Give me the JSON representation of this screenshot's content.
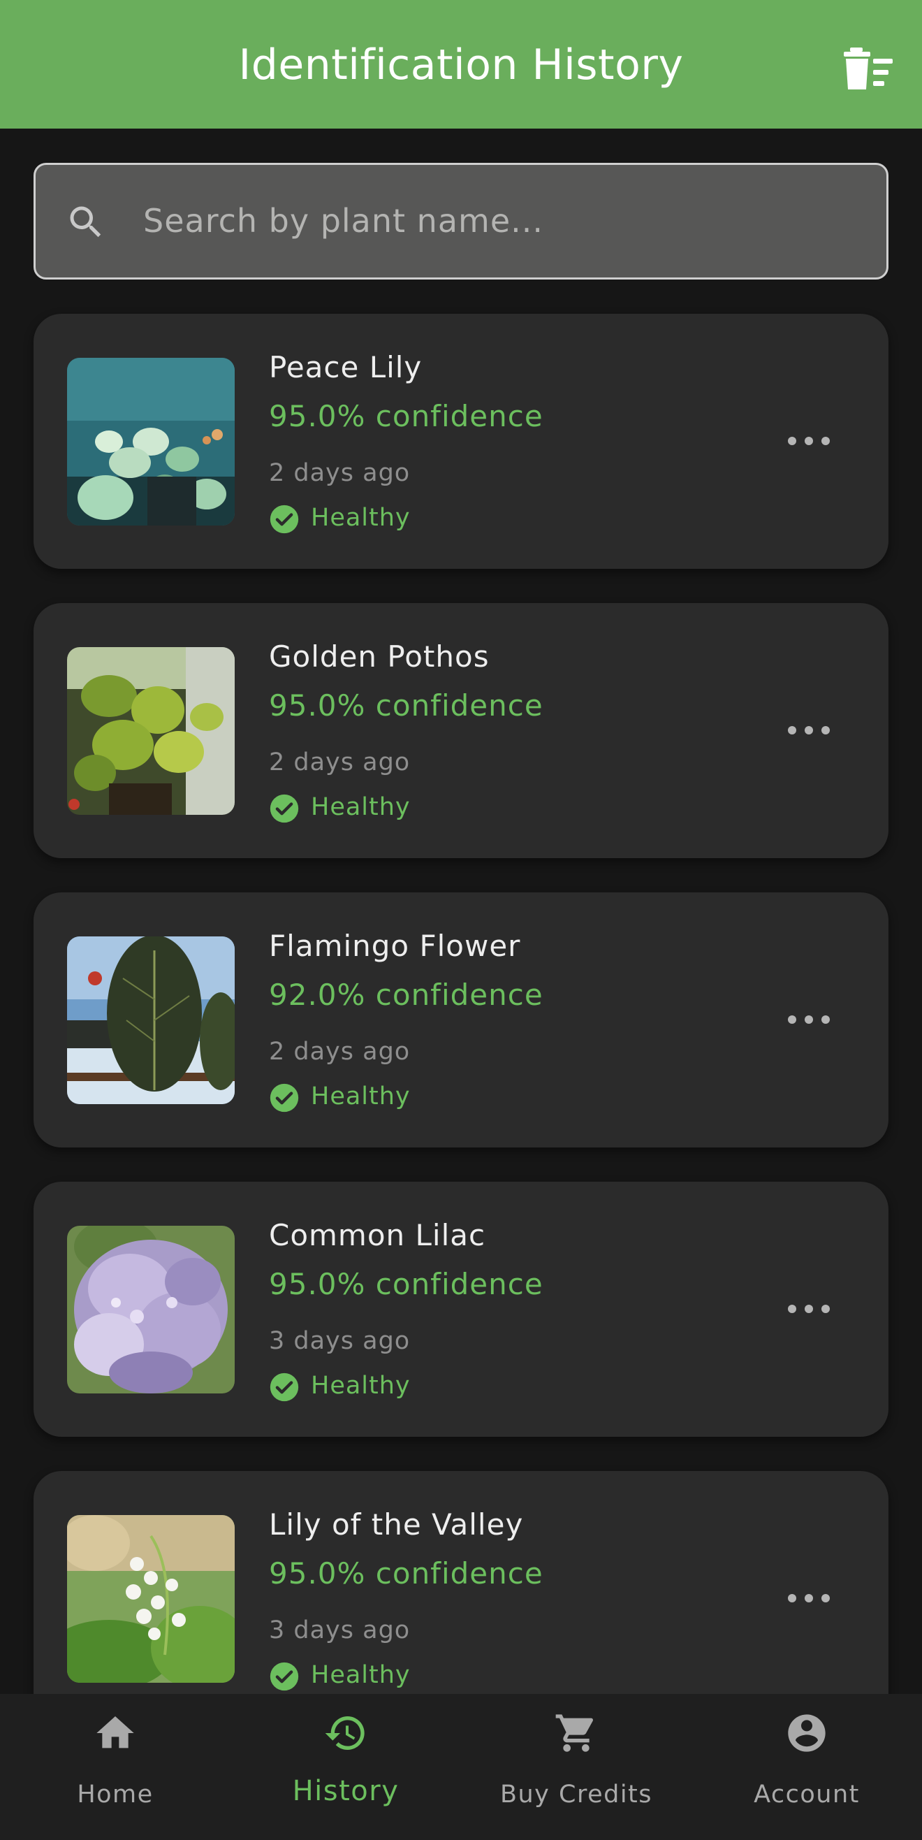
{
  "header": {
    "title": "Identification History",
    "delete_icon": "delete-sweep-icon"
  },
  "search": {
    "placeholder": "Search by plant name...",
    "value": "",
    "icon": "search-icon"
  },
  "items": [
    {
      "name": "Peace Lily",
      "confidence": "95.0% confidence",
      "time": "2 days ago",
      "status": "Healthy",
      "status_icon": "check-circle-icon",
      "more_icon": "more-horizontal-icon"
    },
    {
      "name": "Golden Pothos",
      "confidence": "95.0% confidence",
      "time": "2 days ago",
      "status": "Healthy",
      "status_icon": "check-circle-icon",
      "more_icon": "more-horizontal-icon"
    },
    {
      "name": "Flamingo Flower",
      "confidence": "92.0% confidence",
      "time": "2 days ago",
      "status": "Healthy",
      "status_icon": "check-circle-icon",
      "more_icon": "more-horizontal-icon"
    },
    {
      "name": "Common Lilac",
      "confidence": "95.0% confidence",
      "time": "3 days ago",
      "status": "Healthy",
      "status_icon": "check-circle-icon",
      "more_icon": "more-horizontal-icon"
    },
    {
      "name": "Lily of the Valley",
      "confidence": "95.0% confidence",
      "time": "3 days ago",
      "status": "Healthy",
      "status_icon": "check-circle-icon",
      "more_icon": "more-horizontal-icon"
    }
  ],
  "nav": {
    "active": "History",
    "items": [
      {
        "label": "Home",
        "icon": "home-icon"
      },
      {
        "label": "History",
        "icon": "history-icon"
      },
      {
        "label": "Buy Credits",
        "icon": "cart-icon"
      },
      {
        "label": "Account",
        "icon": "account-circle-icon"
      }
    ]
  },
  "colors": {
    "header": "#6aae5c",
    "accent": "#6cbf5e",
    "background": "#161616",
    "card": "#2b2b2b",
    "nav_background": "#1f1f1f"
  }
}
